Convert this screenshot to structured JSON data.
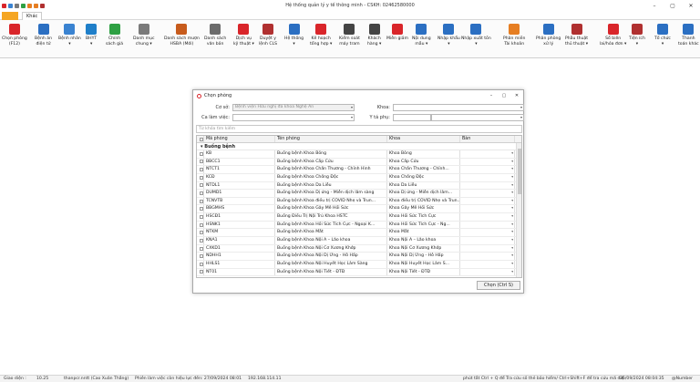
{
  "app": {
    "title": "Hệ thống quản lý y tế thông minh - CSKH: 02462580000"
  },
  "tabs": {
    "other": "Khác"
  },
  "ribbon": [
    {
      "label": "Chọn phòng\n(F12)",
      "icon": "hospital-icon",
      "color": "#d9252a"
    },
    {
      "label": "Bệnh án\nđiện tử",
      "icon": "monitor-icon",
      "color": "#2b6fc2"
    },
    {
      "label": "Bệnh nhân\n▾",
      "icon": "user-icon",
      "color": "#3a83d1"
    },
    {
      "label": "BHYT\n▾",
      "icon": "shield-icon",
      "color": "#1f7fc9"
    },
    {
      "label": "Chính\nsách giá",
      "icon": "policy-icon",
      "color": "#2ea043"
    },
    {
      "label": "Danh mục\nchung ▾",
      "icon": "list-icon",
      "color": "#7a7a7a"
    },
    {
      "label": "Danh sách mượn\nHSBA (Mới)",
      "icon": "folder-icon",
      "color": "#c75b1c"
    },
    {
      "label": "Danh sách\nvăn bản",
      "icon": "document-icon",
      "color": "#6b6b6b"
    },
    {
      "label": "Dịch vụ\nkỹ thuật ▾",
      "icon": "medical-kit-icon",
      "color": "#d9252a"
    },
    {
      "label": "Duyệt y\nlệnh CLS",
      "icon": "pen-icon",
      "color": "#b03030"
    },
    {
      "label": "Hệ thống\n▾",
      "icon": "gear-icon",
      "color": "#2b6fc2"
    },
    {
      "label": "Kế hoạch\ntổng hợp ▾",
      "icon": "plan-icon",
      "color": "#d9252a"
    },
    {
      "label": "Kiểm soát\nmáy tram",
      "icon": "computer-icon",
      "color": "#444444"
    },
    {
      "label": "Khách\nhàng ▾",
      "icon": "headset-icon",
      "color": "#444444"
    },
    {
      "label": "Miễn giảm",
      "icon": "discount-icon",
      "color": "#d9252a"
    },
    {
      "label": "Nội dung\nmẫu ▾",
      "icon": "template-icon",
      "color": "#2b6fc2"
    },
    {
      "label": "Nhập khẩu\n▾",
      "icon": "import-icon",
      "color": "#2b6fc2"
    },
    {
      "label": "Nhập xuất tồn\n▾",
      "icon": "warehouse-icon",
      "color": "#2b6fc2"
    },
    {
      "label": "Phân miền\nTài khoản",
      "icon": "windows-icon",
      "color": "#e67e22"
    },
    {
      "label": "Phân phòng\nxử lý",
      "icon": "room-assign-icon",
      "color": "#2b6fc2"
    },
    {
      "label": "Phẫu thuật\nthủ thuật ▾",
      "icon": "surgery-icon",
      "color": "#b03030"
    },
    {
      "label": "Sổ biên\nlai/hóa đơn ▾",
      "icon": "invoice-icon",
      "color": "#d9252a"
    },
    {
      "label": "Tiện ích\n▾",
      "icon": "tools-icon",
      "color": "#b03030"
    },
    {
      "label": "Tổ chức\n▾",
      "icon": "organization-icon",
      "color": "#2b6fc2"
    },
    {
      "label": "Thanh\ntoán khác",
      "icon": "payment-icon",
      "color": "#2b6fc2"
    }
  ],
  "dialog": {
    "title": "Chọn phòng",
    "facility_label": "Cơ sở:",
    "facility_value": "Bệnh viện Hữu nghị đa khoa Nghệ An",
    "department_label": "Khoa:",
    "shift_label": "Ca làm việc:",
    "nurse_label": "Y tá phụ:",
    "search_placeholder": "Từ khóa tìm kiếm",
    "select_button": "Chọn (Ctrl S)",
    "columns": {
      "code": "Mã phòng",
      "name": "Tên phòng",
      "department": "Khoa",
      "table": "Bàn"
    },
    "group": "Buồng bệnh",
    "rows": [
      {
        "code": "KB",
        "name": "Buồng bệnh Khoa Bỏng",
        "department": "Khoa Bỏng"
      },
      {
        "code": "BBCC1",
        "name": "Buồng bệnh Khoa Cấp Cứu",
        "department": "Khoa Cấp Cứu"
      },
      {
        "code": "NTCT1",
        "name": "Buồng bệnh Khoa Chấn Thương - Chỉnh Hình",
        "department": "Khoa Chấn Thương - Chỉnh..."
      },
      {
        "code": "KCĐ",
        "name": "Buồng bệnh Khoa Chống Độc",
        "department": "Khoa Chống Độc"
      },
      {
        "code": "NTDL1",
        "name": "Buồng bệnh Khoa Da Liễu",
        "department": "Khoa Da Liễu"
      },
      {
        "code": "DUMD1",
        "name": "Buồng bệnh Khoa Dị ứng - Miễn dịch lâm sàng",
        "department": "Khoa Dị ứng - Miễn dịch lâm..."
      },
      {
        "code": "TCNVTB",
        "name": "Buồng bệnh Khoa điều trị COVID Nhẹ và Trun...",
        "department": "Khoa điều trị COVID Nhẹ và Trun..."
      },
      {
        "code": "BBGMHS",
        "name": "Buồng bệnh Khoa Gây Mê Hồi Sức",
        "department": "Khoa Gây Mê Hồi Sức"
      },
      {
        "code": "HSCĐ1",
        "name": "Buồng Điều Trị Nội Trú Khoa HSTC",
        "department": "Khoa Hồi Sức Tích Cực"
      },
      {
        "code": "HSNK1",
        "name": "Buồng bệnh Khoa Hồi Sức Tích Cực - Ngoại K...",
        "department": "Khoa Hồi Sức Tích Cực - Ng..."
      },
      {
        "code": "NTKM",
        "name": "Buồng bệnh Khoa Mắt",
        "department": "Khoa Mắt"
      },
      {
        "code": "KNA1",
        "name": "Buồng bệnh Khoa Nội A – Lão khoa",
        "department": "Khoa Nội A – Lão khoa"
      },
      {
        "code": "CXKD1",
        "name": "Buồng bệnh Khoa Nội Cơ Xương Khớp",
        "department": "Khoa Nội Cơ Xương Khớp"
      },
      {
        "code": "NDHH1",
        "name": "Buồng bệnh Khoa Nội Dị Ứng - Hô Hấp",
        "department": "Khoa Nội Dị Ứng - Hô Hấp"
      },
      {
        "code": "HHLS1",
        "name": "Buồng bệnh Khoa Nội Huyết Học Lâm Sàng",
        "department": "Khoa Nội Huyết Học Lâm S..."
      },
      {
        "code": "NT01",
        "name": "Buồng bệnh Khoa Nội Tiết - ĐTĐ",
        "department": "Khoa Nội Tiết - ĐTĐ"
      }
    ]
  },
  "status": {
    "shift": "Giao diện :",
    "version": "10.25",
    "user": "thanpcr.nntt (Cao Xuân Thắng)",
    "session": "Phiên làm việc còn hiệu lực đến: 27/09/2024 08:01",
    "ip": "192.168.114.11",
    "hint": "phút tắt Ctrl + Q để Tra cứu số thẻ bảo hiểm/ Ctrl+Shift+F để tra cứu mã điệ",
    "datetime": "26/09/2024 08:04:35",
    "numlock": "@Number"
  }
}
